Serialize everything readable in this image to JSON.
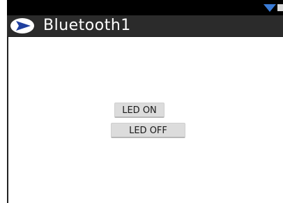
{
  "app": {
    "title": "Bluetooth1"
  },
  "buttons": {
    "led_on": "LED ON",
    "led_off": "LED OFF"
  },
  "icons": {
    "app": "play-icon",
    "wifi": "wifi-icon",
    "signal": "signal-icon"
  },
  "colors": {
    "title_bar": "#2b2b2b",
    "status_bar": "#000000",
    "accent": "#3a7bd5",
    "button": "#dcdcdc"
  }
}
